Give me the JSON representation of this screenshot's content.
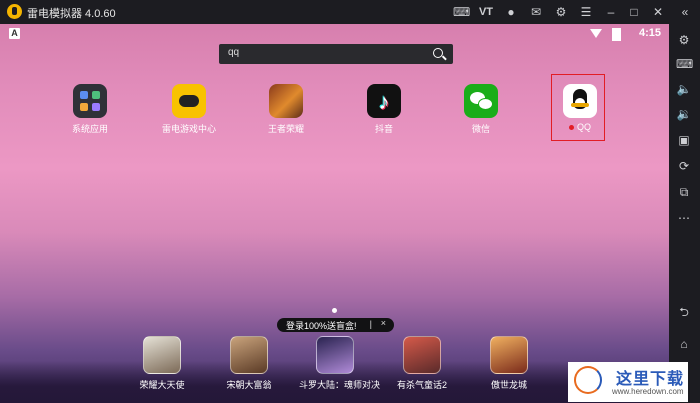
{
  "window": {
    "title": "雷电模拟器 4.0.60",
    "controls": [
      "gamepad-icon",
      "vt-icon",
      "user-icon",
      "mail-icon",
      "settings-icon",
      "minimize-icon",
      "maximize-icon",
      "close-icon",
      "collapse-icon"
    ],
    "vt_label": "VT"
  },
  "statusbar": {
    "time": "4:15",
    "a_label": "A"
  },
  "search": {
    "value": "qq"
  },
  "apps": [
    {
      "label": "系统应用"
    },
    {
      "label": "雷电游戏中心"
    },
    {
      "label": "王者荣耀"
    },
    {
      "label": "抖音"
    },
    {
      "label": "微信"
    },
    {
      "label": "QQ"
    }
  ],
  "banner": {
    "text": "登录100%送盲盒!",
    "sep": "|",
    "close": "×"
  },
  "dock": [
    {
      "label": "荣耀大天使"
    },
    {
      "label": "宋朝大富翁"
    },
    {
      "label": "斗罗大陆：魂师对决"
    },
    {
      "label": "有杀气童话2"
    },
    {
      "label": "傲世龙城"
    }
  ],
  "sidebar": [
    "settings-icon",
    "keyboard-icon",
    "volume-up-icon",
    "volume-down-icon",
    "screenshot-icon",
    "rotate-icon",
    "multi-window-icon",
    "more-icon",
    "back-icon",
    "home-icon"
  ],
  "watermark": {
    "name": "这里下载",
    "url": "www.heredown.com"
  },
  "colors": {
    "accent": "#e21d25",
    "chrome": "#1c1c21"
  }
}
